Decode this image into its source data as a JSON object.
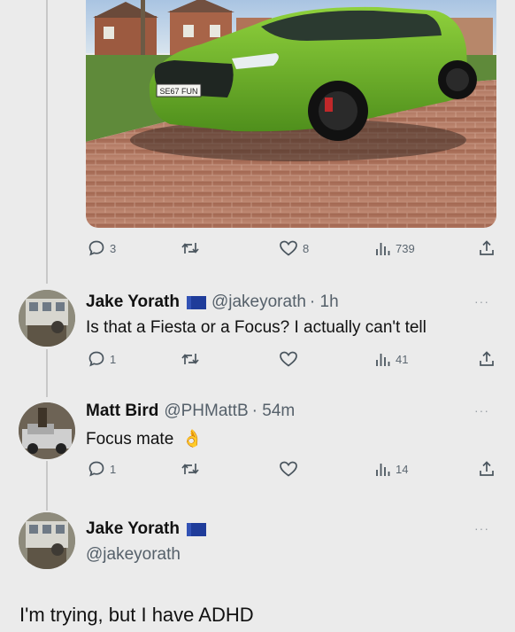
{
  "photo": {
    "plate": "SE67 FUN",
    "car_color": "#6fb52a"
  },
  "post_actions": {
    "replies": "3",
    "likes": "8",
    "views": "739"
  },
  "tweets": [
    {
      "name": "Jake Yorath",
      "handle": "@jakeyorath",
      "time": "· 1h",
      "text": "Is that a Fiesta or a Focus? I actually can't tell",
      "replies": "1",
      "views": "41"
    },
    {
      "name": "Matt Bird",
      "handle": "@PHMattB",
      "time": "· 54m",
      "text": "Focus mate",
      "emoji": "👌",
      "replies": "1",
      "views": "14"
    }
  ],
  "expanded": {
    "name": "Jake Yorath",
    "handle": "@jakeyorath",
    "text": "I'm trying, but I have ADHD"
  },
  "more_label": "···",
  "icons": [
    "reply-icon",
    "retweet-icon",
    "like-icon",
    "views-icon",
    "share-icon",
    "eu-flag-icon",
    "more-icon"
  ]
}
